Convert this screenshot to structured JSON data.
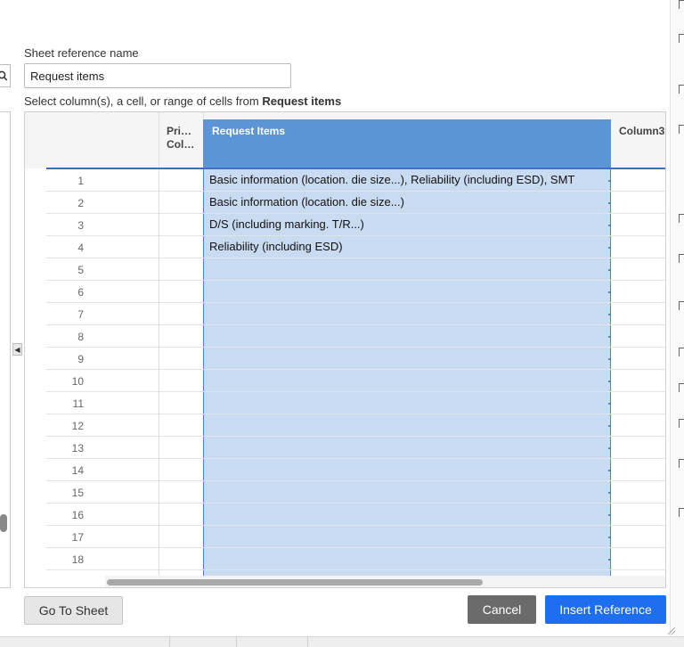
{
  "dialog": {
    "sheet_reference_label": "Sheet reference name",
    "sheet_reference_value": "Request items",
    "select_prefix": "Select column(s), a cell, or range of cells from ",
    "select_sheet_name": "Request items"
  },
  "grid": {
    "columns": {
      "primary_line1": "Pri…",
      "primary_line2": "Col…",
      "request_items": "Request Items",
      "column3": "Column3"
    },
    "row_numbers": [
      "1",
      "2",
      "3",
      "4",
      "5",
      "6",
      "7",
      "8",
      "9",
      "10",
      "11",
      "12",
      "13",
      "14",
      "15",
      "16",
      "17",
      "18"
    ],
    "request_items_cells": [
      "Basic information (location. die size...), Reliability (including ESD), SMT",
      "Basic information (location. die size...)",
      "D/S (including marking. T/R...)",
      "Reliability (including ESD)"
    ]
  },
  "buttons": {
    "go_to_sheet": "Go To Sheet",
    "cancel": "Cancel",
    "insert_reference": "Insert Reference"
  },
  "colors": {
    "selected_header": "#5b95d6",
    "selected_column": "#c9dbf1",
    "primary_button": "#1e6ff0",
    "cancel_button": "#6b6b6b"
  }
}
